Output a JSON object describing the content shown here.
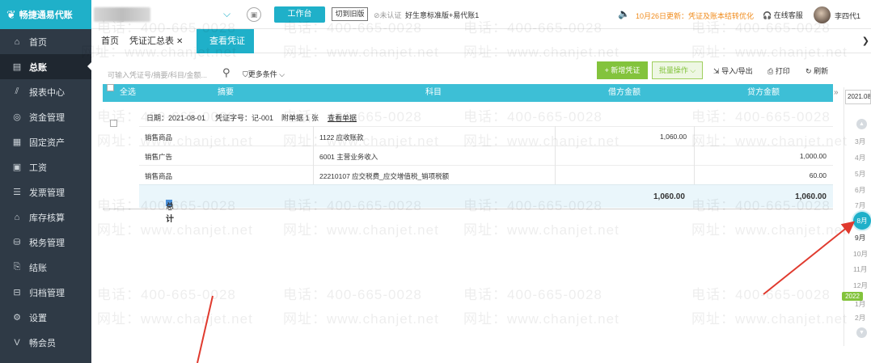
{
  "topbar": {
    "logo_text": "畅捷通易代账",
    "workbench_label": "工作台",
    "old_version_label": "切到旧版",
    "unverified_label": "未认证",
    "company_name": "好生意标准版+易代账1",
    "notice_text": "10月26日更新：凭证及账本结转优化",
    "support_label": "在线客服",
    "username": "李四代1"
  },
  "sidebar": {
    "items": [
      {
        "label": "首页",
        "icon": "home-icon"
      },
      {
        "label": "总账",
        "icon": "ledger-icon"
      },
      {
        "label": "报表中心",
        "icon": "report-icon"
      },
      {
        "label": "资金管理",
        "icon": "fund-icon"
      },
      {
        "label": "固定资产",
        "icon": "asset-icon"
      },
      {
        "label": "工资",
        "icon": "salary-icon"
      },
      {
        "label": "发票管理",
        "icon": "invoice-icon"
      },
      {
        "label": "库存核算",
        "icon": "inventory-icon"
      },
      {
        "label": "税务管理",
        "icon": "tax-icon"
      },
      {
        "label": "结账",
        "icon": "checkout-icon"
      },
      {
        "label": "归档管理",
        "icon": "archive-icon"
      },
      {
        "label": "设置",
        "icon": "gear-icon"
      },
      {
        "label": "畅会员",
        "icon": "member-icon"
      }
    ],
    "active_index": 1
  },
  "tabs": [
    {
      "label": "首页"
    },
    {
      "label": "凭证汇总表"
    },
    {
      "label": "查看凭证"
    }
  ],
  "toolbar": {
    "search_placeholder": "可输入凭证号/摘要/科目/金额...",
    "more_conditions": "更多条件",
    "new_voucher": "+ 新增凭证",
    "batch_ops": "批量操作",
    "import_export": "导入/导出",
    "print": "打印",
    "refresh": "刷新"
  },
  "table": {
    "headers": {
      "select_all": "全选",
      "summary": "摘要",
      "account": "科目",
      "debit": "借方金额",
      "credit": "贷方金额"
    },
    "voucher": {
      "date": "日期：2021-08-01",
      "voucher_no": "凭证字号：记-001",
      "attachments": "附单据 1 张",
      "view_docs": "查看单据"
    },
    "entries": [
      {
        "summary": "销售商品",
        "account": "1122 应收账款",
        "debit": "1,060.00",
        "credit": ""
      },
      {
        "summary": "销售广告",
        "account": "6001 主营业务收入",
        "debit": "",
        "credit": "1,000.00"
      },
      {
        "summary": "销售商品",
        "account": "22210107 应交税费_应交增值税_销项税额",
        "debit": "",
        "credit": "60.00"
      }
    ],
    "total": {
      "label": "总计",
      "debit": "1,060.00",
      "credit": "1,060.00"
    }
  },
  "month_picker": {
    "year_value": "2021.08",
    "months": [
      "3月",
      "4月",
      "5月",
      "6月",
      "7月",
      "8月",
      "9月",
      "10月",
      "11月",
      "12月",
      "1月",
      "2月"
    ],
    "selected": "8月",
    "next_year": "2022"
  },
  "watermark": {
    "phone": "电话：400-665-0028",
    "site": "网址：www.chanjet.net"
  },
  "colors": {
    "brand": "#1fb0c9",
    "sidebar_bg": "#2f3a46",
    "green": "#83c33c",
    "notice": "#f08b1c",
    "arrow": "#e03a2e"
  }
}
